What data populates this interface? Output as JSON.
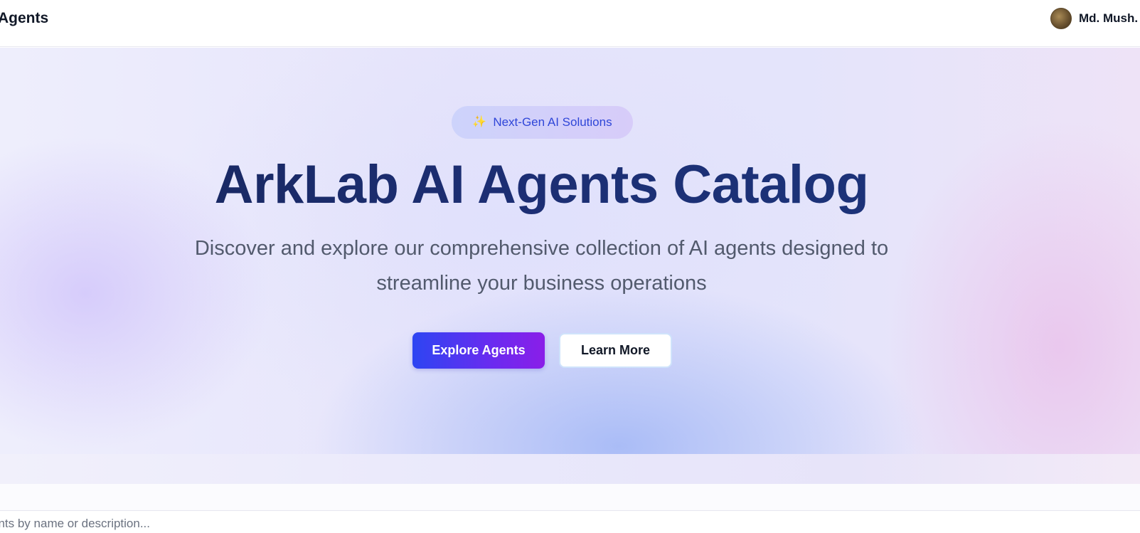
{
  "header": {
    "brand": "Agents",
    "user_name": "Md. Mush."
  },
  "hero": {
    "badge_icon": "sparkles-icon",
    "badge_text": "Next-Gen AI Solutions",
    "title": "ArkLab AI Agents Catalog",
    "subtitle": "Discover and explore our comprehensive collection of AI agents designed to streamline your business operations",
    "primary_button": "Explore Agents",
    "secondary_button": "Learn More"
  },
  "search": {
    "placeholder": "ents by name or description..."
  },
  "colors": {
    "accent_start": "#2d45f2",
    "accent_end": "#8a1ee8",
    "title": "#1c2e73",
    "badge_text": "#2f46d8"
  }
}
